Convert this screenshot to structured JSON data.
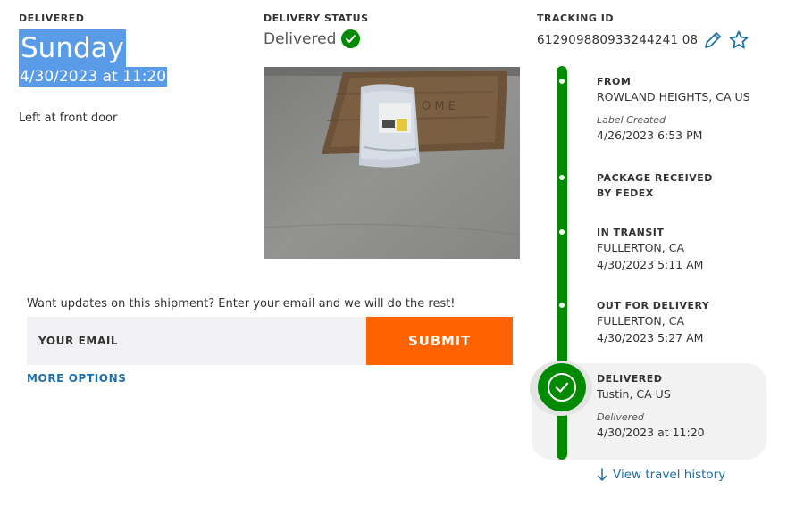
{
  "delivered": {
    "label": "DELIVERED",
    "day": "Sunday",
    "datetime": "4/30/2023 at 11:20",
    "left_at": "Left at front door"
  },
  "status": {
    "label": "DELIVERY STATUS",
    "value": "Delivered",
    "icon": "check-circle-icon"
  },
  "tracking": {
    "label": "TRACKING ID",
    "number": "612909880933244241 08",
    "edit_icon": "pencil-icon",
    "favorite_icon": "star-icon"
  },
  "email": {
    "prompt": "Want updates on this shipment? Enter your email and we will do the rest!",
    "placeholder": "YOUR EMAIL",
    "submit_label": "SUBMIT",
    "more_options": "MORE OPTIONS"
  },
  "timeline": {
    "events": [
      {
        "title": "FROM",
        "line1": "ROWLAND HEIGHTS, CA US",
        "note": "Label Created",
        "time": "4/26/2023 6:53 PM"
      },
      {
        "title": "PACKAGE RECEIVED BY FEDEX"
      },
      {
        "title": "IN TRANSIT",
        "line1": "FULLERTON, CA",
        "time": "4/30/2023 5:11 AM"
      },
      {
        "title": "OUT FOR DELIVERY",
        "line1": "FULLERTON, CA",
        "time": "4/30/2023 5:27 AM"
      },
      {
        "title": "DELIVERED",
        "line1": "Tustin, CA US",
        "note": "Delivered",
        "time": "4/30/2023 at 11:20"
      }
    ],
    "view_history": "View travel history"
  },
  "colors": {
    "brand_green": "#008a00",
    "submit_orange": "#ff6200",
    "link_blue": "#1f6fa8",
    "selection_blue": "#5a9be8"
  }
}
